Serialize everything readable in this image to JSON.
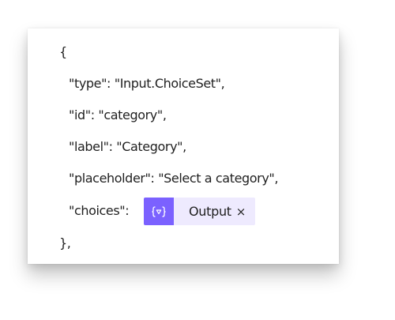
{
  "code": {
    "open_brace": "{",
    "type_line": "\"type\": \"Input.ChoiceSet\",",
    "id_line": "\"id\": \"category\",",
    "label_line": "\"label\": \"Category\",",
    "placeholder_line": "\"placeholder\": \"Select a category\",",
    "choices_key": "\"choices\":",
    "close_brace": "},"
  },
  "token": {
    "icon": "expression-icon",
    "label": "Output",
    "remove_glyph": "×",
    "accent_color": "#7b61ff",
    "background_color": "#eeeafe"
  }
}
